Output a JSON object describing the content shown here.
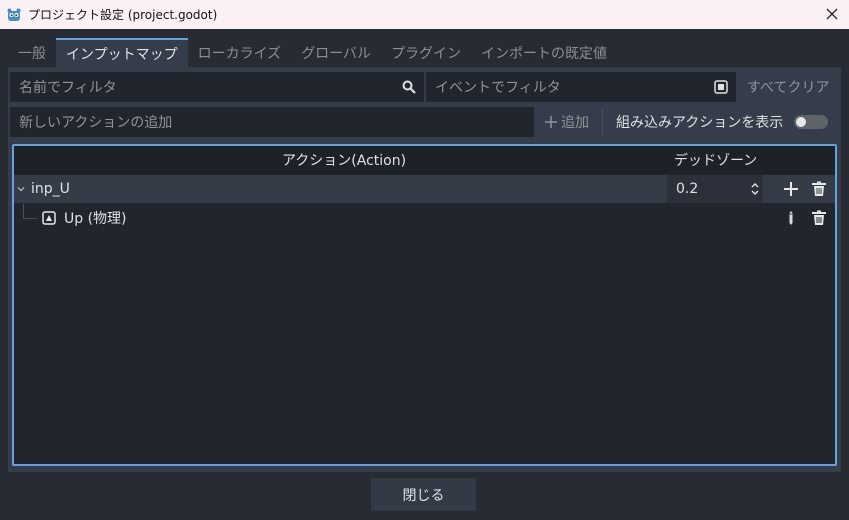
{
  "window": {
    "title": "プロジェクト設定 (project.godot)",
    "icon": "godot-icon",
    "close_icon": "close-icon"
  },
  "tabs": [
    {
      "label": "一般",
      "active": false
    },
    {
      "label": "インプットマップ",
      "active": true
    },
    {
      "label": "ローカライズ",
      "active": false
    },
    {
      "label": "グローバル",
      "active": false
    },
    {
      "label": "プラグイン",
      "active": false
    },
    {
      "label": "インポートの既定値",
      "active": false
    }
  ],
  "filters": {
    "name_placeholder": "名前でフィルタ",
    "event_placeholder": "イベントでフィルタ",
    "clear_all": "すべてクリア"
  },
  "add_action": {
    "placeholder": "新しいアクションの追加",
    "add_label": "追加",
    "show_builtin_label": "組み込みアクションを表示",
    "show_builtin_enabled": false
  },
  "tree": {
    "columns": [
      "アクション(Action)",
      "デッドゾーン"
    ],
    "rows": [
      {
        "name": "inp_U",
        "deadzone": "0.2",
        "expanded": true
      },
      {
        "name": "Up (物理)"
      }
    ]
  },
  "footer": {
    "close_label": "閉じる"
  },
  "colors": {
    "accent": "#6aa1dd",
    "panel": "#363d4a",
    "background": "#272c34"
  }
}
